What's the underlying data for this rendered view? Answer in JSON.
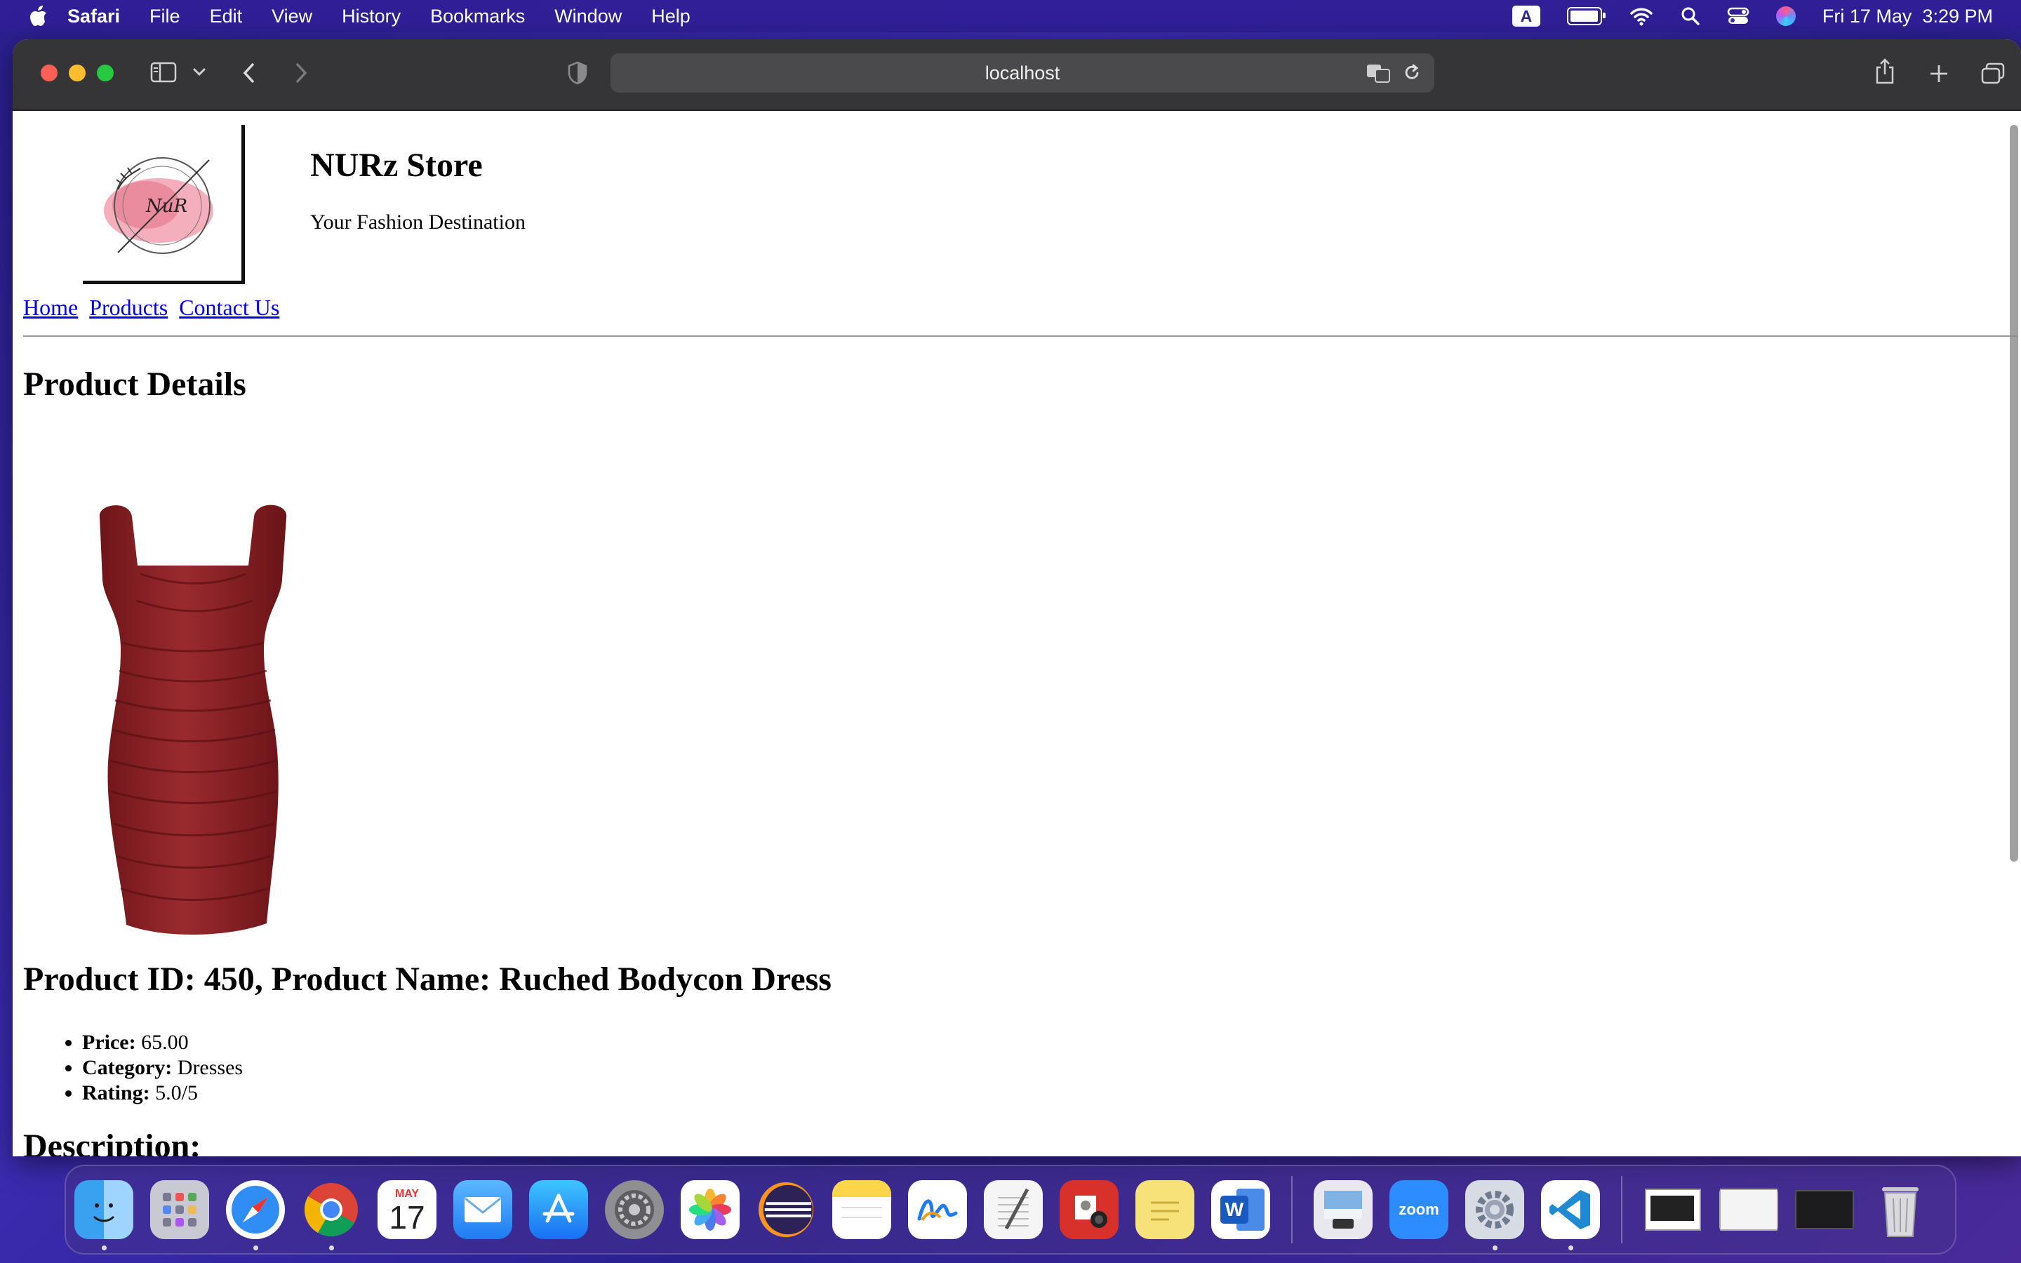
{
  "menubar": {
    "app_name": "Safari",
    "items": [
      "File",
      "Edit",
      "View",
      "History",
      "Bookmarks",
      "Window",
      "Help"
    ],
    "input_indicator": "A",
    "battery_level": 0.85,
    "datetime": "Fri 17 May  3:29 PM"
  },
  "browser": {
    "url": "localhost"
  },
  "site": {
    "name": "NURz Store",
    "tagline": "Your Fashion Destination",
    "nav": [
      "Home",
      "Products",
      "Contact Us"
    ],
    "colors": {
      "link": "#0000ee",
      "dress": "#8e1f24"
    }
  },
  "product": {
    "section_title": "Product Details",
    "heading": "Product ID: 450, Product Name: Ruched Bodycon Dress",
    "price_label": "Price:",
    "price": "65.00",
    "category_label": "Category:",
    "category": "Dresses",
    "rating_label": "Rating:",
    "rating": "5.0/5",
    "description_heading": "Description:"
  },
  "dock": {
    "calendar_month": "MAY",
    "calendar_day": "17",
    "zoom_label": "zoom",
    "word_label": "W",
    "apps": [
      "Finder",
      "Launchpad",
      "Safari",
      "Chrome",
      "Calendar",
      "Mail",
      "App Store",
      "System Settings",
      "Photos",
      "Eclipse",
      "Notes",
      "Freeform",
      "TextEdit",
      "Photo Booth",
      "Stickies",
      "Microsoft Word",
      "Preview",
      "Zoom",
      "Settings",
      "Visual Studio Code",
      "Trash"
    ]
  }
}
